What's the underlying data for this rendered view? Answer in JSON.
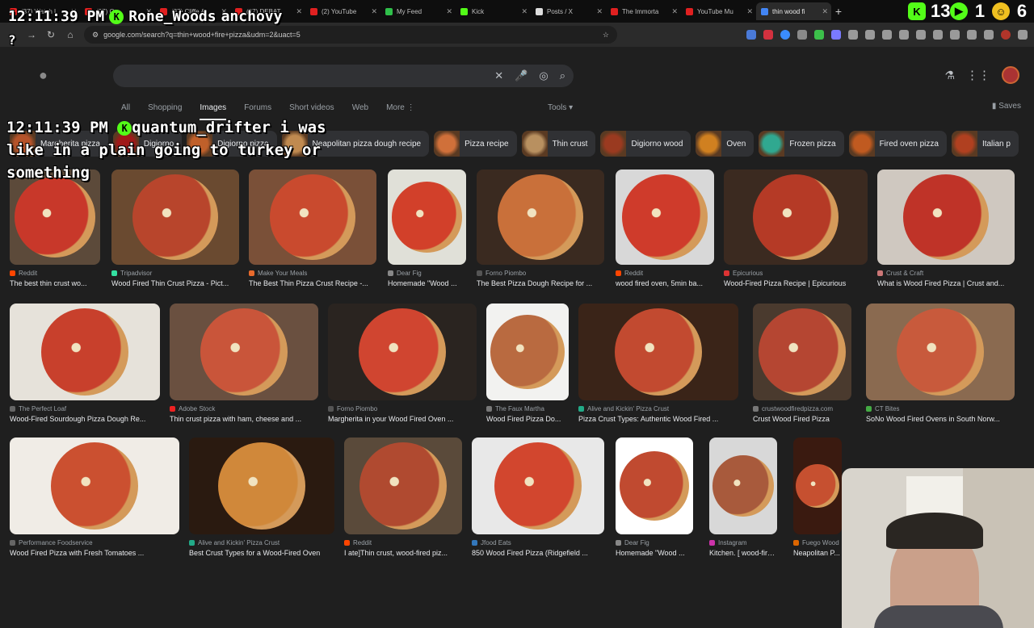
{
  "tabs": [
    {
      "label": "(37) Watch L",
      "color": "#e02020"
    },
    {
      "label": "(37) Ov...",
      "color": "#e02020"
    },
    {
      "label": "(37) Cliffe &",
      "color": "#e02020"
    },
    {
      "label": "(37) DEBAT",
      "color": "#e02020"
    },
    {
      "label": "(2) YouTube",
      "color": "#e02020"
    },
    {
      "label": "My Feed",
      "color": "#2fbf4a"
    },
    {
      "label": "Kick",
      "color": "#53fc18"
    },
    {
      "label": "Posts / X",
      "color": "#dddddd"
    },
    {
      "label": "The Immorta",
      "color": "#e02020"
    },
    {
      "label": "YouTube Mu",
      "color": "#e02020"
    },
    {
      "label": "thin wood fi",
      "color": "#4285f4",
      "active": true
    }
  ],
  "ext_numbers": {
    "a": "13",
    "b": "1",
    "c": "6"
  },
  "address": {
    "url": "google.com/search?q=thin+wood+fire+pizza&udm=2&uact=5"
  },
  "overlay": {
    "chat1": {
      "time": "12:11:39 PM",
      "user": "Rone_Woods",
      "msg": "anchovy",
      "extra": "?"
    },
    "chat2": {
      "time": "12:11:39 PM",
      "user": "quantum_drifter",
      "msg": "i was like in a plain going to turkey or something"
    }
  },
  "nav": {
    "tabs": [
      "All",
      "Shopping",
      "Images",
      "Forums",
      "Short videos",
      "Web",
      "More"
    ],
    "tools": "Tools",
    "saves": "Saves"
  },
  "chips": [
    {
      "label": "Margherita pizza",
      "color": "#b5532a"
    },
    {
      "label": "Digiorno",
      "color": "#a01818"
    },
    {
      "label": "Digiorno pizza",
      "color": "#c0602a"
    },
    {
      "label": "Neapolitan pizza dough recipe",
      "color": "#c08a50"
    },
    {
      "label": "Pizza recipe",
      "color": "#d0703a"
    },
    {
      "label": "Thin crust",
      "color": "#b89060"
    },
    {
      "label": "Digiorno wood",
      "color": "#9a3a20"
    },
    {
      "label": "Oven",
      "color": "#d08020"
    },
    {
      "label": "Frozen pizza",
      "color": "#30a890"
    },
    {
      "label": "Fired oven pizza",
      "color": "#c05a20"
    },
    {
      "label": "Italian p",
      "color": "#b04020"
    }
  ],
  "results": [
    {
      "source": "Reddit",
      "caption": "The best thin crust wo...",
      "sfav": "#ff4500"
    },
    {
      "source": "Tripadvisor",
      "caption": "Wood Fired Thin Crust Pizza - Pict...",
      "sfav": "#34e0a1"
    },
    {
      "source": "Make Your Meals",
      "caption": "The Best Thin Pizza Crust Recipe -...",
      "sfav": "#e86a2c"
    },
    {
      "source": "Dear Fig",
      "caption": "Homemade \"Wood ...",
      "sfav": "#888888"
    },
    {
      "source": "Forno Piombo",
      "caption": "The Best Pizza Dough Recipe for ...",
      "sfav": "#555555"
    },
    {
      "source": "Reddit",
      "caption": "wood fired oven, 5min ba...",
      "sfav": "#ff4500"
    },
    {
      "source": "Epicurious",
      "caption": "Wood-Fired Pizza Recipe | Epicurious",
      "sfav": "#d33"
    },
    {
      "source": "Crust & Craft",
      "caption": "What is Wood Fired Pizza | Crust and...",
      "sfav": "#c77"
    },
    {
      "source": "The Perfect Loaf",
      "caption": "Wood-Fired Sourdough Pizza Dough Re...",
      "sfav": "#666666"
    },
    {
      "source": "Adobe Stock",
      "caption": "Thin crust pizza with ham, cheese and ...",
      "sfav": "#e22"
    },
    {
      "source": "Forno Piombo",
      "caption": "Margherita in your Wood Fired Oven ...",
      "sfav": "#555555"
    },
    {
      "source": "The Faux Martha",
      "caption": "Wood Fired Pizza Do...",
      "sfav": "#777777"
    },
    {
      "source": "Alive and Kickin' Pizza Crust",
      "caption": "Pizza Crust Types: Authentic Wood Fired ...",
      "sfav": "#2a8"
    },
    {
      "source": "crustwoodfiredpizza.com",
      "caption": "Crust Wood Fired Pizza",
      "sfav": "#777777"
    },
    {
      "source": "CT Bites",
      "caption": "SoNo Wood Fired Ovens in South Norw...",
      "sfav": "#4a4"
    },
    {
      "source": "Performance Foodservice",
      "caption": "Wood Fired Pizza with Fresh Tomatoes ...",
      "sfav": "#666666"
    },
    {
      "source": "Alive and Kickin' Pizza Crust",
      "caption": "Best Crust Types for a Wood-Fired Oven",
      "sfav": "#2a8"
    },
    {
      "source": "Reddit",
      "caption": "I ate]Thin crust, wood-fired piz...",
      "sfav": "#ff4500"
    },
    {
      "source": "Jfood Eats",
      "caption": "850 Wood Fired Pizza (Ridgefield ...",
      "sfav": "#37b"
    },
    {
      "source": "Dear Fig",
      "caption": "Homemade \"Wood ...",
      "sfav": "#888888"
    },
    {
      "source": "Instagram",
      "caption": "Kitchen. [ wood-fire...",
      "sfav": "#c3a"
    },
    {
      "source": "Fuego Wood",
      "caption": "Neapolitan P...",
      "sfav": "#d60"
    }
  ]
}
